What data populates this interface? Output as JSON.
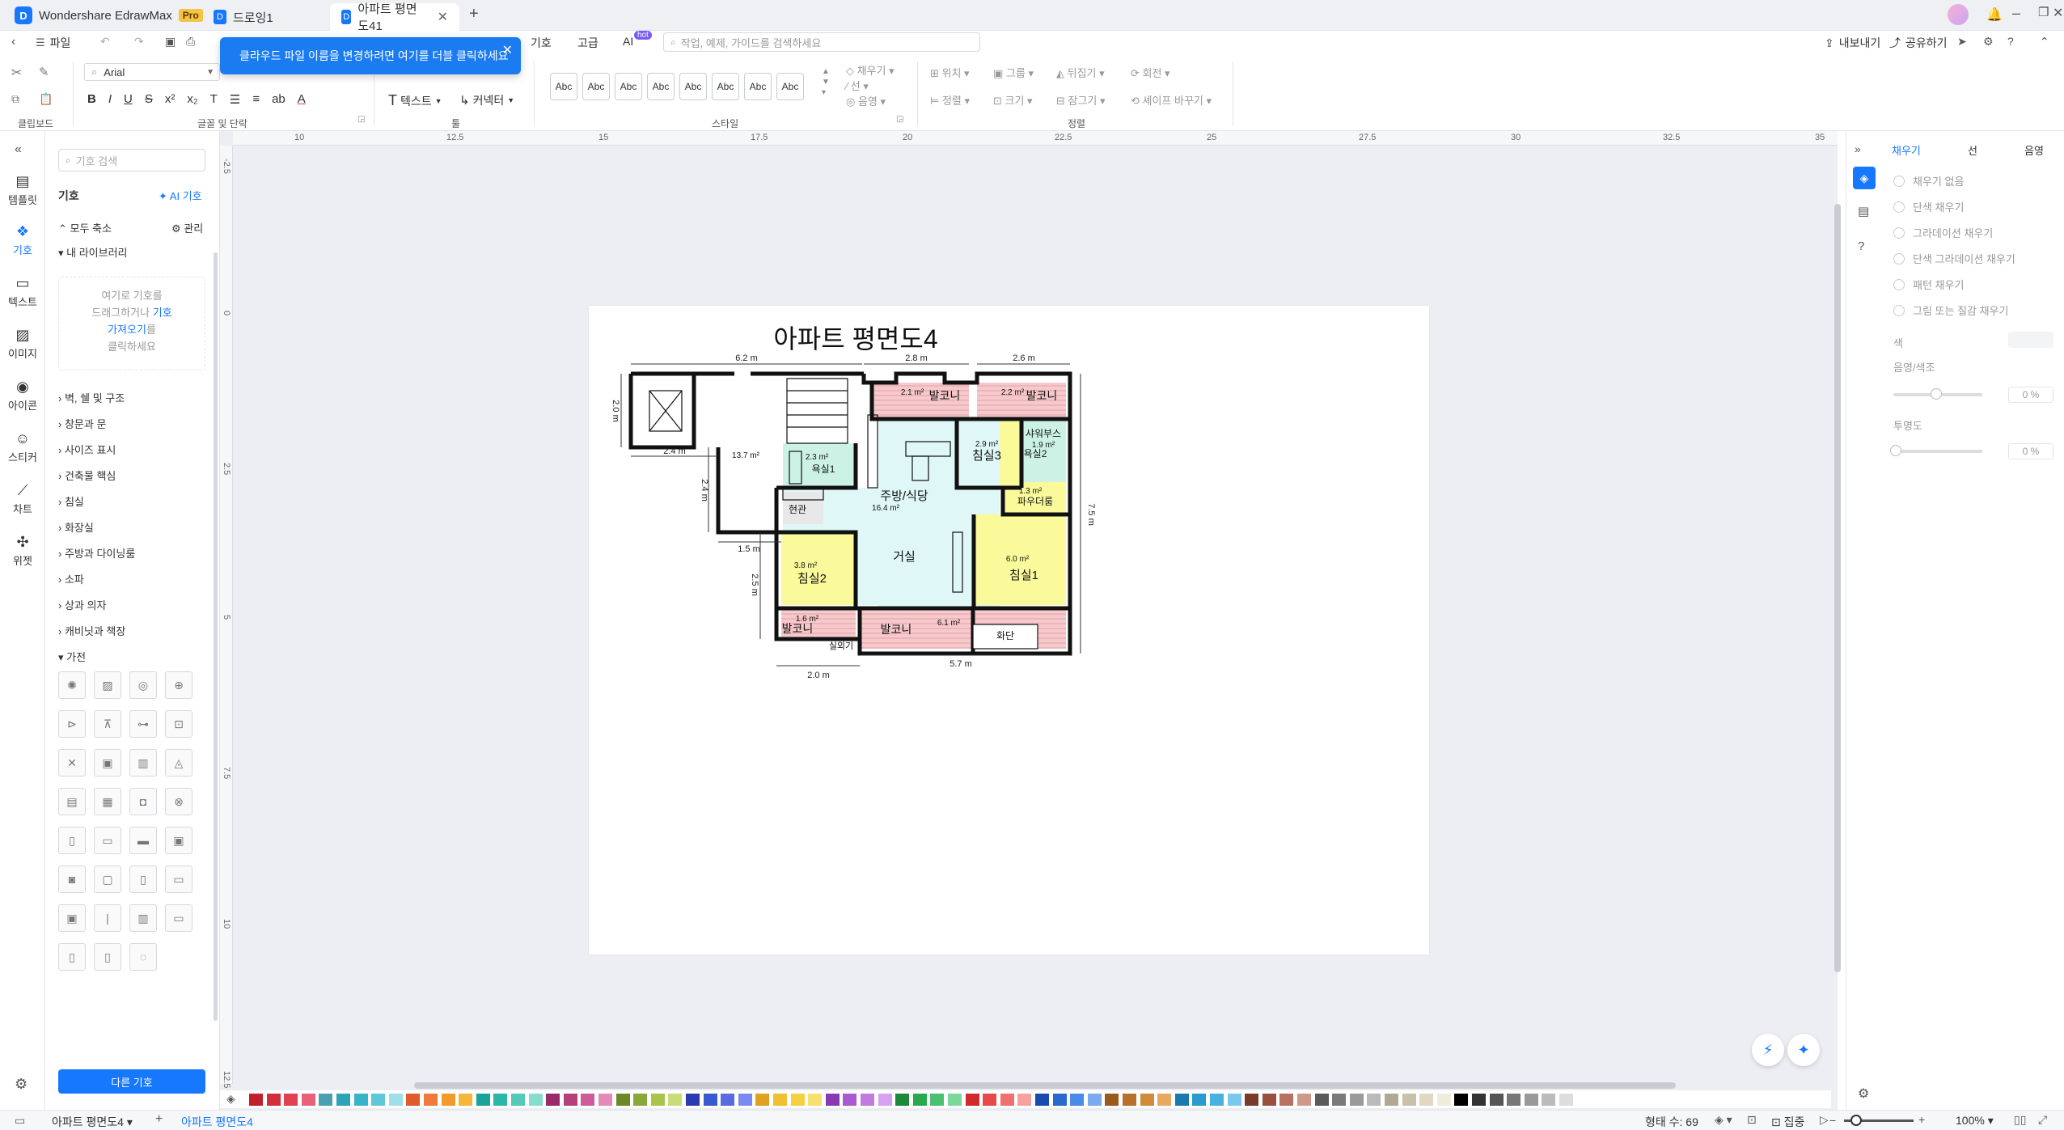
{
  "titlebar": {
    "app_name": "Wondershare EdrawMax",
    "pro_badge": "Pro",
    "tabs": [
      {
        "label": "드로잉1",
        "active": false
      },
      {
        "label": "아파트 평면도41",
        "active": true
      }
    ],
    "new_tab": "+"
  },
  "menubar": {
    "file": "파일",
    "items": [
      "기호",
      "고급",
      "AI"
    ],
    "ai_badge": "hot",
    "search_placeholder": "작업, 예제, 가이드를 검색하세요",
    "export": "내보내기",
    "share": "공유하기"
  },
  "toast": {
    "message": "클라우드 파일 이름을 변경하려면 여기를 더블 클릭하세요"
  },
  "ribbon": {
    "font_name": "Arial",
    "group_labels": [
      "클립보드",
      "글꼴 및 단락",
      "툴",
      "스타일",
      "정렬"
    ],
    "text_tool": "텍스트",
    "connector_tool": "커넥터",
    "style_sample": "Abc",
    "style_count": 8,
    "fill": "채우기",
    "line": "선",
    "shadow": "음영",
    "position": "위치",
    "group": "그룹",
    "flip": "뒤집기",
    "rotate": "회전",
    "align": "정렬",
    "size": "크기",
    "lock": "잠그기",
    "replace_shape": "셰이프 바꾸기"
  },
  "left_nav": {
    "items": [
      {
        "label": "템플릿",
        "icon": "template-icon"
      },
      {
        "label": "기호",
        "icon": "symbol-icon",
        "active": true
      },
      {
        "label": "텍스트",
        "icon": "text-icon"
      },
      {
        "label": "이미지",
        "icon": "image-icon"
      },
      {
        "label": "아이콘",
        "icon": "icon-icon"
      },
      {
        "label": "스티커",
        "icon": "sticker-icon"
      },
      {
        "label": "차트",
        "icon": "chart-icon"
      },
      {
        "label": "위젯",
        "icon": "widget-icon"
      }
    ]
  },
  "library": {
    "search_placeholder": "기호 검색",
    "title": "기호",
    "ai_symbol": "AI 기호",
    "collapse_all": "모두 축소",
    "manage": "관리",
    "my_library": "내 라이브러리",
    "drop_hint_1": "여기로 기호를",
    "drop_hint_2": "드래그하거나",
    "drop_hint_link_1": "기호",
    "drop_hint_link_2": "가져오기",
    "drop_hint_3": "를",
    "drop_hint_4": "클릭하세요",
    "categories": [
      "벽, 쉘 및 구조",
      "창문과 문",
      "사이즈 표시",
      "건축물 핵심",
      "침실",
      "화장실",
      "주방과 다이닝룸",
      "소파",
      "상과 의자",
      "캐비닛과 책장",
      "가전"
    ],
    "more_symbols": "다른 기호"
  },
  "rulers": {
    "top": [
      "10",
      "12.5",
      "15",
      "17.5",
      "20",
      "22.5",
      "25",
      "27.5",
      "30",
      "32.5",
      "35"
    ],
    "left": [
      "-2.5",
      "0",
      "2.5",
      "5",
      "7.5",
      "10",
      "12.5"
    ]
  },
  "floorplan": {
    "title": "아파트 평면도4",
    "dims": {
      "top_left": "6.2 m",
      "top_mid": "2.8 m",
      "top_right": "2.6 m",
      "left_top": "2.0 m",
      "left_mid_h": "2.4 m",
      "left_mid_v": "2.4 m",
      "left_bottom_h": "1.5 m",
      "left_bottom_v": "2.5 m",
      "right": "7.5 m",
      "bottom_left": "2.0 m",
      "bottom_right": "5.7 m"
    },
    "rooms": {
      "balcony_top_left_area": "2.1 m²",
      "balcony_top_left": "발코니",
      "balcony_top_right_area": "2.2 m²",
      "balcony_top_right": "발코니",
      "shower_booth": "샤워부스",
      "shower_area": "1.9 m²",
      "bath2": "욕실2",
      "bedroom3_area": "2.9 m²",
      "bedroom3": "침실3",
      "bath1_area": "2.3 m²",
      "bath1": "욕실1",
      "hall_area": "13.7 m²",
      "powder_area": "1.3 m²",
      "powder": "파우더룸",
      "kitchen": "주방/식당",
      "kitchen_area": "16.4 m²",
      "entrance": "현관",
      "living": "거실",
      "bedroom2_area": "3.8 m²",
      "bedroom2": "침실2",
      "bedroom1_area": "6.0 m²",
      "bedroom1": "침실1",
      "balcony_bl_area": "1.6 m²",
      "balcony_bl": "발코니",
      "balcony_bottom": "발코니",
      "balcony_bottom_area": "6.1 m²",
      "planter": "화단",
      "outdoor_unit": "실외기"
    }
  },
  "right_panel": {
    "tabs": [
      "채우기",
      "선",
      "음영"
    ],
    "fill_options": [
      "채우기 없음",
      "단색 채우기",
      "그라데이션 채우기",
      "단색 그라데이션 채우기",
      "패턴 채우기",
      "그림 또는 질감 채우기"
    ],
    "color_label": "색",
    "shade_label": "음영/색조",
    "shade_value": "0 %",
    "transparency_label": "투명도",
    "transparency_value": "0 %"
  },
  "colors": [
    "#c0202a",
    "#d32f3a",
    "#e04050",
    "#e8607a",
    "#4a9fb0",
    "#2ea3b8",
    "#36b5c8",
    "#5ec8d8",
    "#a0dfe8",
    "#e05a2a",
    "#ef7a3a",
    "#f29a2a",
    "#f5b73a",
    "#1aa39a",
    "#2bb7a8",
    "#54c9b8",
    "#88dccd",
    "#9a2a6a",
    "#b8407a",
    "#d05a9a",
    "#e48ab8",
    "#6a8a2a",
    "#8aa83a",
    "#a8c44a",
    "#c8dc7a",
    "#2a3ab0",
    "#3a5ad0",
    "#5a6ae0",
    "#7a8af0",
    "#e0a020",
    "#f0c030",
    "#f5d040",
    "#f8e070",
    "#8a3ab0",
    "#a85ad0",
    "#c07ae0",
    "#d8a0f0",
    "#1a8a3a",
    "#2aa850",
    "#4ac070",
    "#7ad898",
    "#d02a2a",
    "#e84a4a",
    "#f07070",
    "#f8a0a0",
    "#1a4ab0",
    "#2a6ad0",
    "#4a8ae8",
    "#7aaaf0",
    "#9a5a1a",
    "#b8702a",
    "#d08a3a",
    "#e8a860",
    "#1a7ab0",
    "#2a9ad0",
    "#4ab0e0",
    "#7ac8f0",
    "#7a3a2a",
    "#9a5040",
    "#b87060",
    "#d09888",
    "#5a5a5a",
    "#7a7a7a",
    "#9a9a9a",
    "#bababa",
    "#b0a890",
    "#c8c0a8",
    "#e0d8c0",
    "#f0ecdc",
    "#000000",
    "#333333",
    "#555555",
    "#777777",
    "#999999",
    "#bbbbbb",
    "#dddddd"
  ],
  "statusbar": {
    "page_tab": "아파트 평면도4",
    "add_page": "+",
    "active_page": "아파트 평면도4",
    "shape_count": "형태 수: 69",
    "focus": "집중",
    "zoom": "100%"
  }
}
